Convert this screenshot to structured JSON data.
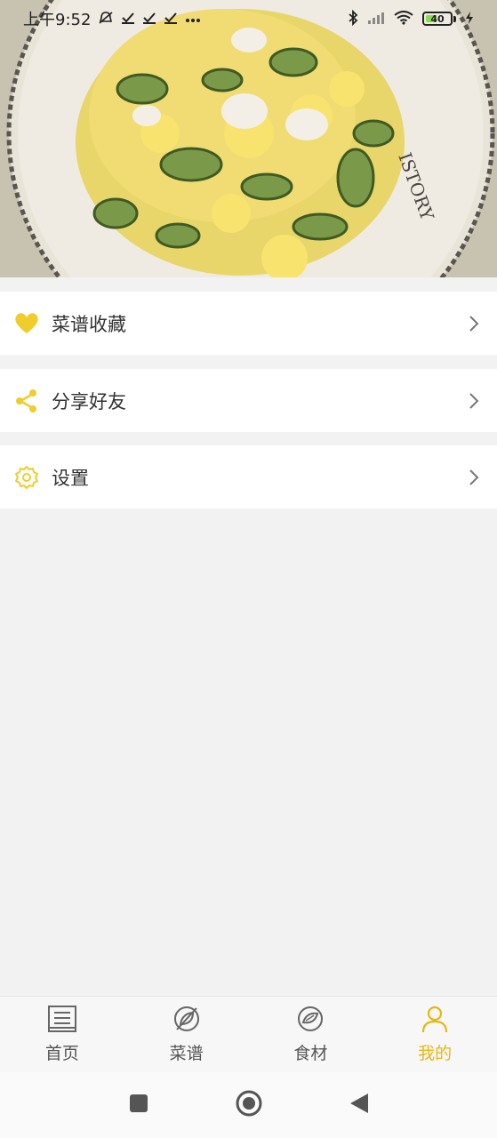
{
  "status_bar": {
    "time": "上午9:52",
    "left_icons": [
      "mute-bell-icon",
      "check-icon",
      "check-icon",
      "check-icon",
      "more-dots-icon"
    ],
    "right_icons": [
      "bluetooth-icon",
      "signal-icon",
      "wifi-icon"
    ],
    "battery_level": "40"
  },
  "header": {
    "image": "food-photo-scrambled-eggs-cucumber",
    "plate_text": "ISTORY"
  },
  "menu": [
    {
      "label": "菜谱收藏",
      "icon": "heart-icon"
    },
    {
      "label": "分享好友",
      "icon": "share-icon"
    },
    {
      "label": "设置",
      "icon": "gear-icon"
    }
  ],
  "tabs": [
    {
      "label": "首页",
      "icon": "home-list-icon",
      "active": false
    },
    {
      "label": "菜谱",
      "icon": "recipe-leaf-icon",
      "active": false
    },
    {
      "label": "食材",
      "icon": "ingredient-cabbage-icon",
      "active": false
    },
    {
      "label": "我的",
      "icon": "user-icon",
      "active": true
    }
  ],
  "colors": {
    "accent": "#e8b710",
    "background": "#f2f2f2",
    "icon_yellow": "#f0cd2d"
  }
}
